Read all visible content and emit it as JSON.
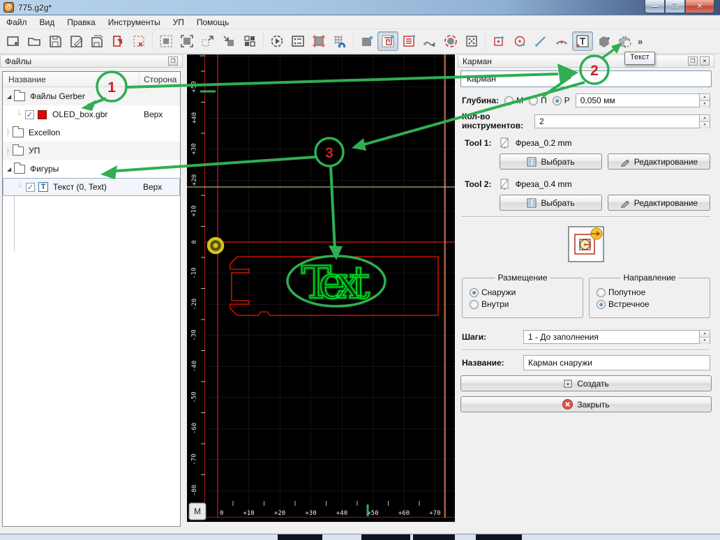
{
  "window": {
    "title": "775.g2g*"
  },
  "menu": {
    "items": [
      "Файл",
      "Вид",
      "Правка",
      "Инструменты",
      "УП",
      "Помощь"
    ],
    "overflow": "»"
  },
  "toolbar": {
    "text_tool_tooltip": "Текст"
  },
  "files_panel": {
    "title": "Файлы",
    "columns": {
      "name": "Название",
      "side": "Сторона"
    },
    "tree": [
      {
        "label": "Файлы Gerber",
        "side": ""
      },
      {
        "label": "OLED_box.gbr",
        "side": "Верх",
        "checked": "✓"
      },
      {
        "label": "Excellon",
        "side": ""
      },
      {
        "label": "УП",
        "side": ""
      },
      {
        "label": "Фигуры",
        "side": ""
      },
      {
        "label": "Текст (0, Text)",
        "side": "Верх",
        "checked": "✓"
      }
    ]
  },
  "canvas": {
    "text_label": "Text",
    "unit_button": "M",
    "ruler_x": [
      "0",
      "+10",
      "+20",
      "+30",
      "+40",
      "+50",
      "+60",
      "+70"
    ],
    "ruler_y": [
      "+50",
      "+40",
      "+30",
      "+20",
      "+10",
      "0",
      "-10",
      "-20",
      "-30",
      "-40",
      "-50",
      "-60",
      "-70",
      "-80"
    ]
  },
  "pocket_panel": {
    "title": "Карман",
    "pocket_name": "Карман",
    "depth": {
      "label": "Глубина:",
      "opt1": "М",
      "opt2": "П",
      "opt3": "Р",
      "value": "0,050 мм"
    },
    "tool_count": {
      "label": "Кол-во инструментов:",
      "value": "2"
    },
    "tools": [
      {
        "label": "Tool 1:",
        "name": "Фреза_0.2 mm"
      },
      {
        "label": "Tool 2:",
        "name": "Фреза_0.4 mm"
      }
    ],
    "choose_label": "Выбрать",
    "edit_label": "Редактирование",
    "placement": {
      "title": "Размещение",
      "opt1": "Снаружи",
      "opt2": "Внутри"
    },
    "direction": {
      "title": "Направление",
      "opt1": "Попутное",
      "opt2": "Встречное"
    },
    "steps": {
      "label": "Шаги:",
      "value": "1 - До заполнения"
    },
    "name_field": {
      "label": "Название:",
      "value": "Карман снаружи"
    },
    "create_label": "Создать",
    "close_label": "Закрыть"
  },
  "annotations": {
    "n1": "1",
    "n2": "2",
    "n3": "3"
  },
  "colors": {
    "annotation_green": "#2fae52",
    "annotation_number_red": "#cc2222",
    "layer_red": "#dd0800",
    "engrave_green": "#00dd22",
    "board_red": "#cc1100"
  }
}
